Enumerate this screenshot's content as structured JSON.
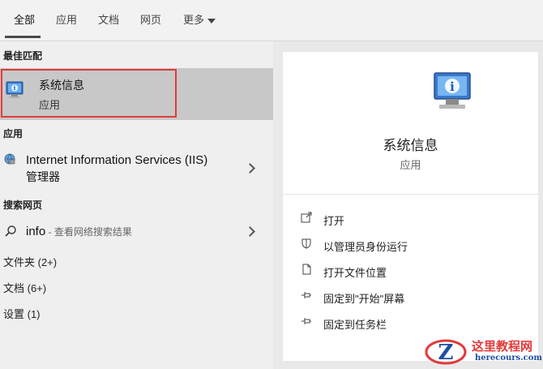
{
  "tabs": [
    {
      "label": "全部"
    },
    {
      "label": "应用"
    },
    {
      "label": "文档"
    },
    {
      "label": "网页"
    },
    {
      "label": "更多"
    }
  ],
  "best_match": {
    "section": "最佳匹配",
    "title": "系统信息",
    "subtitle": "应用"
  },
  "apps": {
    "section": "应用",
    "item_line1": "Internet Information Services (IIS)",
    "item_line2": "管理器"
  },
  "web": {
    "section": "搜索网页",
    "query": "info",
    "desc": " - 查看网络搜索结果"
  },
  "categories": [
    {
      "label": "文件夹 (2+)"
    },
    {
      "label": "文档 (6+)"
    },
    {
      "label": "设置 (1)"
    }
  ],
  "details": {
    "title": "系统信息",
    "subtitle": "应用",
    "actions": [
      {
        "label": "打开",
        "icon": "open-icon"
      },
      {
        "label": "以管理员身份运行",
        "icon": "shield-icon"
      },
      {
        "label": "打开文件位置",
        "icon": "file-location-icon"
      },
      {
        "label": "固定到\"开始\"屏幕",
        "icon": "pin-icon"
      },
      {
        "label": "固定到任务栏",
        "icon": "pin-icon"
      }
    ]
  },
  "watermark": {
    "name": "这里教程网",
    "url": "herecours.com"
  }
}
